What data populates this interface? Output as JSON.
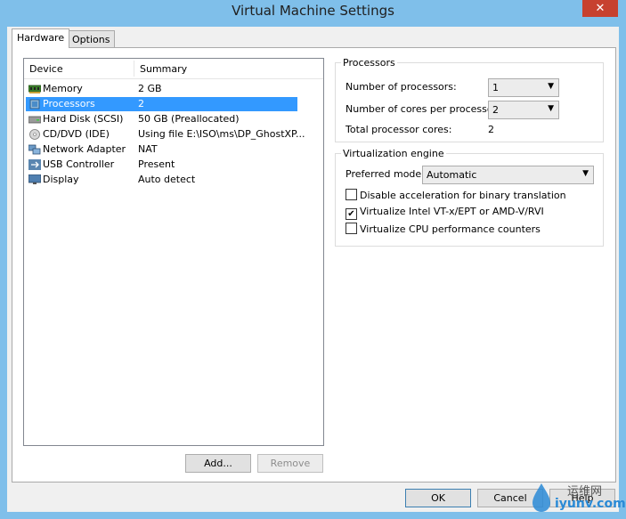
{
  "window": {
    "title": "Virtual Machine Settings",
    "close_label": "✕"
  },
  "tabs": [
    {
      "label": "Hardware"
    },
    {
      "label": "Options"
    }
  ],
  "device_list": {
    "columns": [
      "Device",
      "Summary"
    ],
    "rows": [
      {
        "device": "Memory",
        "summary": "2 GB",
        "icon": "memory-icon"
      },
      {
        "device": "Processors",
        "summary": "2",
        "icon": "processor-icon"
      },
      {
        "device": "Hard Disk (SCSI)",
        "summary": "50 GB (Preallocated)",
        "icon": "hard-disk-icon"
      },
      {
        "device": "CD/DVD (IDE)",
        "summary": "Using file E:\\ISO\\ms\\DP_GhostXP...",
        "icon": "cd-dvd-icon"
      },
      {
        "device": "Network Adapter",
        "summary": "NAT",
        "icon": "network-adapter-icon"
      },
      {
        "device": "USB Controller",
        "summary": "Present",
        "icon": "usb-icon"
      },
      {
        "device": "Display",
        "summary": "Auto detect",
        "icon": "display-icon"
      }
    ]
  },
  "list_buttons": {
    "add": "Add...",
    "remove": "Remove"
  },
  "processors": {
    "title": "Processors",
    "num_processors_label": "Number of processors:",
    "num_processors_value": "1",
    "cores_label": "Number of cores per processor:",
    "cores_value": "2",
    "total_label": "Total processor cores:",
    "total_value": "2"
  },
  "virtualization": {
    "title": "Virtualization engine",
    "mode_label": "Preferred mode:",
    "mode_value": "Automatic",
    "options": [
      {
        "label": "Disable acceleration for binary translation",
        "checked": false
      },
      {
        "label": "Virtualize Intel VT-x/EPT or AMD-V/RVI",
        "checked": true
      },
      {
        "label": "Virtualize CPU performance counters",
        "checked": false
      }
    ]
  },
  "footer": {
    "ok": "OK",
    "cancel": "Cancel",
    "help": "Help"
  },
  "watermark": {
    "line1": "运维网",
    "line2": "iyunv.com"
  }
}
